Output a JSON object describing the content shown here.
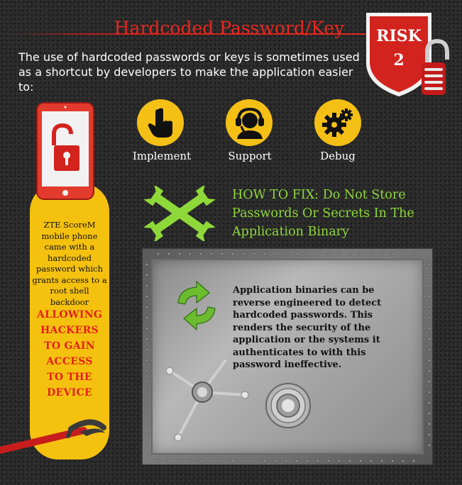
{
  "header": {
    "title": "Hardcoded Password/Key",
    "intro": "The use of hardcoded passwords or keys is sometimes used as a shortcut by developers to make the application easier to:"
  },
  "risk_badge": {
    "label": "RISK",
    "number": "2",
    "color": "#d3231e"
  },
  "icons": [
    {
      "label": "Implement",
      "icon": "pointing-hand-icon"
    },
    {
      "label": "Support",
      "icon": "headset-icon"
    },
    {
      "label": "Debug",
      "icon": "gears-icon"
    }
  ],
  "fix": {
    "title": "HOW TO FIX: Do Not Store Passwords Or Secrets In The Application Binary",
    "color": "#8fd83a"
  },
  "story": {
    "text": "ZTE ScoreM mobile phone came with a hardcoded password which grants access to a root shell backdoor",
    "alarm_lines": [
      "ALLOWING",
      "HACKERS",
      "TO GAIN",
      "ACCESS",
      "TO THE",
      "DEVICE"
    ]
  },
  "vault": {
    "text": "Application binaries can be reverse engineered to detect hardcoded passwords. This renders the security of the application or the systems it authenticates to with this password ineffective."
  },
  "colors": {
    "accent_yellow": "#f4c10f",
    "accent_red": "#e4201b",
    "background": "#2a2a2a"
  }
}
